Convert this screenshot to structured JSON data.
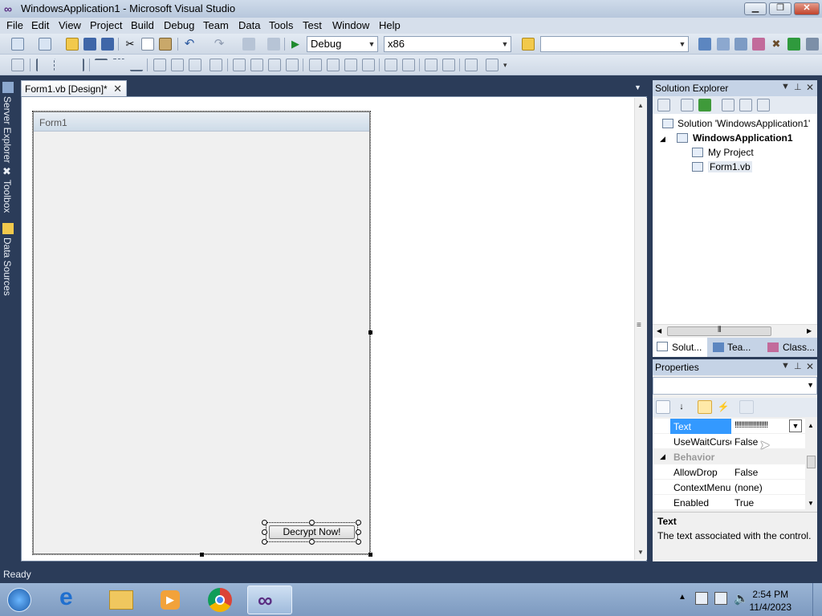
{
  "window": {
    "title": "WindowsApplication1 - Microsoft Visual Studio"
  },
  "menu": [
    "File",
    "Edit",
    "View",
    "Project",
    "Build",
    "Debug",
    "Team",
    "Data",
    "Tools",
    "Test",
    "Window",
    "Help"
  ],
  "toolbar": {
    "config": "Debug",
    "platform": "x86",
    "find": ""
  },
  "side_tabs": [
    "Server Explorer",
    "Toolbox",
    "Data Sources"
  ],
  "document": {
    "tab": "Form1.vb [Design]*",
    "form_title": "Form1",
    "button_text": "Decrypt Now!"
  },
  "solution_explorer": {
    "title": "Solution Explorer",
    "nodes": [
      "Solution 'WindowsApplication1'",
      "WindowsApplication1",
      "My Project",
      "Form1.vb"
    ],
    "tabs": [
      "Solut...",
      "Tea...",
      "Class..."
    ]
  },
  "properties": {
    "title": "Properties",
    "rows": [
      {
        "name": "Text",
        "value": "!!!!!!!!!!!!!!!!!!!!",
        "selected": true
      },
      {
        "name": "UseWaitCursor",
        "value": "False"
      },
      {
        "name": "Behavior",
        "value": "",
        "category": true
      },
      {
        "name": "AllowDrop",
        "value": "False"
      },
      {
        "name": "ContextMenuStrip",
        "value": "(none)"
      },
      {
        "name": "Enabled",
        "value": "True"
      }
    ],
    "desc_title": "Text",
    "desc_text": "The text associated with the control."
  },
  "status": "Ready",
  "clock": {
    "time": "2:54 PM",
    "date": "11/4/2023"
  },
  "colors": {
    "chrome": "#2b3c59",
    "selection": "#3399ff"
  }
}
